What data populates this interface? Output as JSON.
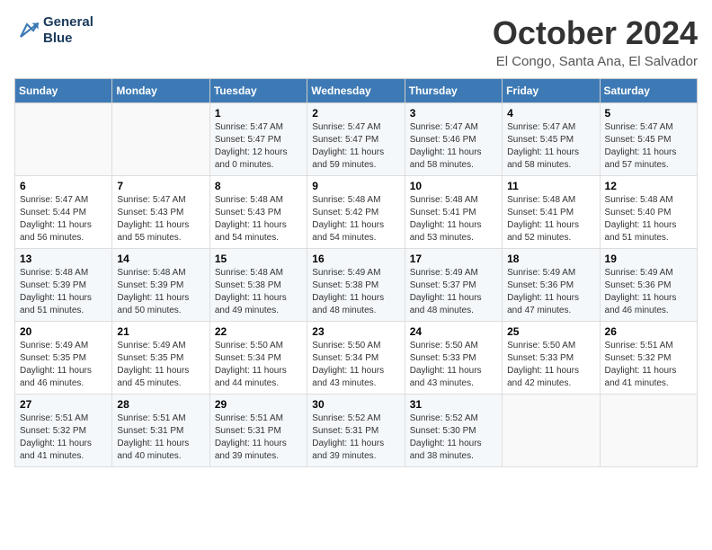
{
  "header": {
    "logo_line1": "General",
    "logo_line2": "Blue",
    "month": "October 2024",
    "location": "El Congo, Santa Ana, El Salvador"
  },
  "days_of_week": [
    "Sunday",
    "Monday",
    "Tuesday",
    "Wednesday",
    "Thursday",
    "Friday",
    "Saturday"
  ],
  "weeks": [
    [
      {
        "day": "",
        "sunrise": "",
        "sunset": "",
        "daylight": ""
      },
      {
        "day": "",
        "sunrise": "",
        "sunset": "",
        "daylight": ""
      },
      {
        "day": "1",
        "sunrise": "Sunrise: 5:47 AM",
        "sunset": "Sunset: 5:47 PM",
        "daylight": "Daylight: 12 hours and 0 minutes."
      },
      {
        "day": "2",
        "sunrise": "Sunrise: 5:47 AM",
        "sunset": "Sunset: 5:47 PM",
        "daylight": "Daylight: 11 hours and 59 minutes."
      },
      {
        "day": "3",
        "sunrise": "Sunrise: 5:47 AM",
        "sunset": "Sunset: 5:46 PM",
        "daylight": "Daylight: 11 hours and 58 minutes."
      },
      {
        "day": "4",
        "sunrise": "Sunrise: 5:47 AM",
        "sunset": "Sunset: 5:45 PM",
        "daylight": "Daylight: 11 hours and 58 minutes."
      },
      {
        "day": "5",
        "sunrise": "Sunrise: 5:47 AM",
        "sunset": "Sunset: 5:45 PM",
        "daylight": "Daylight: 11 hours and 57 minutes."
      }
    ],
    [
      {
        "day": "6",
        "sunrise": "Sunrise: 5:47 AM",
        "sunset": "Sunset: 5:44 PM",
        "daylight": "Daylight: 11 hours and 56 minutes."
      },
      {
        "day": "7",
        "sunrise": "Sunrise: 5:47 AM",
        "sunset": "Sunset: 5:43 PM",
        "daylight": "Daylight: 11 hours and 55 minutes."
      },
      {
        "day": "8",
        "sunrise": "Sunrise: 5:48 AM",
        "sunset": "Sunset: 5:43 PM",
        "daylight": "Daylight: 11 hours and 54 minutes."
      },
      {
        "day": "9",
        "sunrise": "Sunrise: 5:48 AM",
        "sunset": "Sunset: 5:42 PM",
        "daylight": "Daylight: 11 hours and 54 minutes."
      },
      {
        "day": "10",
        "sunrise": "Sunrise: 5:48 AM",
        "sunset": "Sunset: 5:41 PM",
        "daylight": "Daylight: 11 hours and 53 minutes."
      },
      {
        "day": "11",
        "sunrise": "Sunrise: 5:48 AM",
        "sunset": "Sunset: 5:41 PM",
        "daylight": "Daylight: 11 hours and 52 minutes."
      },
      {
        "day": "12",
        "sunrise": "Sunrise: 5:48 AM",
        "sunset": "Sunset: 5:40 PM",
        "daylight": "Daylight: 11 hours and 51 minutes."
      }
    ],
    [
      {
        "day": "13",
        "sunrise": "Sunrise: 5:48 AM",
        "sunset": "Sunset: 5:39 PM",
        "daylight": "Daylight: 11 hours and 51 minutes."
      },
      {
        "day": "14",
        "sunrise": "Sunrise: 5:48 AM",
        "sunset": "Sunset: 5:39 PM",
        "daylight": "Daylight: 11 hours and 50 minutes."
      },
      {
        "day": "15",
        "sunrise": "Sunrise: 5:48 AM",
        "sunset": "Sunset: 5:38 PM",
        "daylight": "Daylight: 11 hours and 49 minutes."
      },
      {
        "day": "16",
        "sunrise": "Sunrise: 5:49 AM",
        "sunset": "Sunset: 5:38 PM",
        "daylight": "Daylight: 11 hours and 48 minutes."
      },
      {
        "day": "17",
        "sunrise": "Sunrise: 5:49 AM",
        "sunset": "Sunset: 5:37 PM",
        "daylight": "Daylight: 11 hours and 48 minutes."
      },
      {
        "day": "18",
        "sunrise": "Sunrise: 5:49 AM",
        "sunset": "Sunset: 5:36 PM",
        "daylight": "Daylight: 11 hours and 47 minutes."
      },
      {
        "day": "19",
        "sunrise": "Sunrise: 5:49 AM",
        "sunset": "Sunset: 5:36 PM",
        "daylight": "Daylight: 11 hours and 46 minutes."
      }
    ],
    [
      {
        "day": "20",
        "sunrise": "Sunrise: 5:49 AM",
        "sunset": "Sunset: 5:35 PM",
        "daylight": "Daylight: 11 hours and 46 minutes."
      },
      {
        "day": "21",
        "sunrise": "Sunrise: 5:49 AM",
        "sunset": "Sunset: 5:35 PM",
        "daylight": "Daylight: 11 hours and 45 minutes."
      },
      {
        "day": "22",
        "sunrise": "Sunrise: 5:50 AM",
        "sunset": "Sunset: 5:34 PM",
        "daylight": "Daylight: 11 hours and 44 minutes."
      },
      {
        "day": "23",
        "sunrise": "Sunrise: 5:50 AM",
        "sunset": "Sunset: 5:34 PM",
        "daylight": "Daylight: 11 hours and 43 minutes."
      },
      {
        "day": "24",
        "sunrise": "Sunrise: 5:50 AM",
        "sunset": "Sunset: 5:33 PM",
        "daylight": "Daylight: 11 hours and 43 minutes."
      },
      {
        "day": "25",
        "sunrise": "Sunrise: 5:50 AM",
        "sunset": "Sunset: 5:33 PM",
        "daylight": "Daylight: 11 hours and 42 minutes."
      },
      {
        "day": "26",
        "sunrise": "Sunrise: 5:51 AM",
        "sunset": "Sunset: 5:32 PM",
        "daylight": "Daylight: 11 hours and 41 minutes."
      }
    ],
    [
      {
        "day": "27",
        "sunrise": "Sunrise: 5:51 AM",
        "sunset": "Sunset: 5:32 PM",
        "daylight": "Daylight: 11 hours and 41 minutes."
      },
      {
        "day": "28",
        "sunrise": "Sunrise: 5:51 AM",
        "sunset": "Sunset: 5:31 PM",
        "daylight": "Daylight: 11 hours and 40 minutes."
      },
      {
        "day": "29",
        "sunrise": "Sunrise: 5:51 AM",
        "sunset": "Sunset: 5:31 PM",
        "daylight": "Daylight: 11 hours and 39 minutes."
      },
      {
        "day": "30",
        "sunrise": "Sunrise: 5:52 AM",
        "sunset": "Sunset: 5:31 PM",
        "daylight": "Daylight: 11 hours and 39 minutes."
      },
      {
        "day": "31",
        "sunrise": "Sunrise: 5:52 AM",
        "sunset": "Sunset: 5:30 PM",
        "daylight": "Daylight: 11 hours and 38 minutes."
      },
      {
        "day": "",
        "sunrise": "",
        "sunset": "",
        "daylight": ""
      },
      {
        "day": "",
        "sunrise": "",
        "sunset": "",
        "daylight": ""
      }
    ]
  ]
}
